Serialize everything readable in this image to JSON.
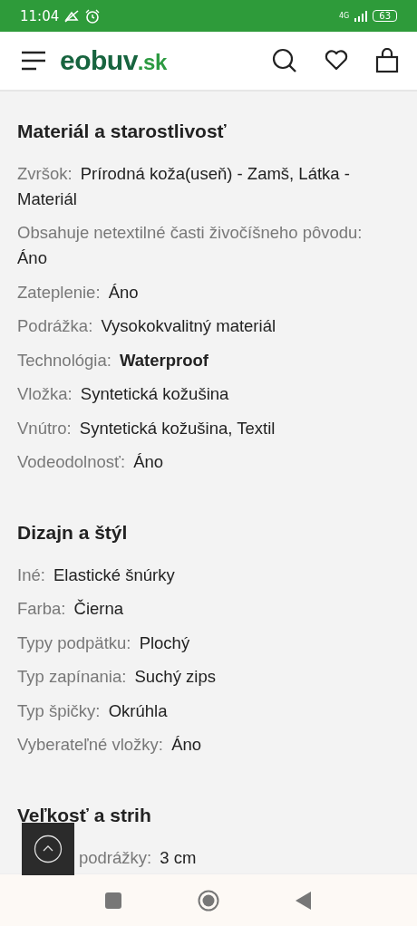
{
  "status_bar": {
    "time": "11:04",
    "network": "4G",
    "battery": "63"
  },
  "header": {
    "logo_main": "eobuv",
    "logo_suffix": ".sk"
  },
  "sections": [
    {
      "title": "Materiál a starostlivosť",
      "rows": [
        {
          "label": "Zvršok:",
          "value": "Prírodná koža(useň) - Zamš, Látka - Materiál",
          "bold": false
        },
        {
          "label": "Obsahuje netextilné časti živočíšneho pôvodu:",
          "value": "Áno",
          "bold": false
        },
        {
          "label": "Zateplenie:",
          "value": "Áno",
          "bold": false
        },
        {
          "label": "Podrážka:",
          "value": "Vysokokvalitný materiál",
          "bold": false
        },
        {
          "label": "Technológia:",
          "value": "Waterproof",
          "bold": true
        },
        {
          "label": "Vložka:",
          "value": "Syntetická kožušina",
          "bold": false
        },
        {
          "label": "Vnútro:",
          "value": "Syntetická kožušina, Textil",
          "bold": false
        },
        {
          "label": "Vodeodolnosť:",
          "value": "Áno",
          "bold": false
        }
      ]
    },
    {
      "title": "Dizajn a štýl",
      "rows": [
        {
          "label": "Iné:",
          "value": "Elastické šnúrky",
          "bold": false
        },
        {
          "label": "Farba:",
          "value": "Čierna",
          "bold": false
        },
        {
          "label": "Typy podpätku:",
          "value": "Plochý",
          "bold": false
        },
        {
          "label": "Typ zapínania:",
          "value": "Suchý zips",
          "bold": false
        },
        {
          "label": "Typ špičky:",
          "value": "Okrúhla",
          "bold": false
        },
        {
          "label": "Vyberateľné vložky:",
          "value": "Áno",
          "bold": false
        }
      ]
    },
    {
      "title": "Veľkosť a strih",
      "rows": [
        {
          "label": "podrážky:",
          "value": "3 cm",
          "bold": false,
          "covered": true
        }
      ]
    }
  ]
}
